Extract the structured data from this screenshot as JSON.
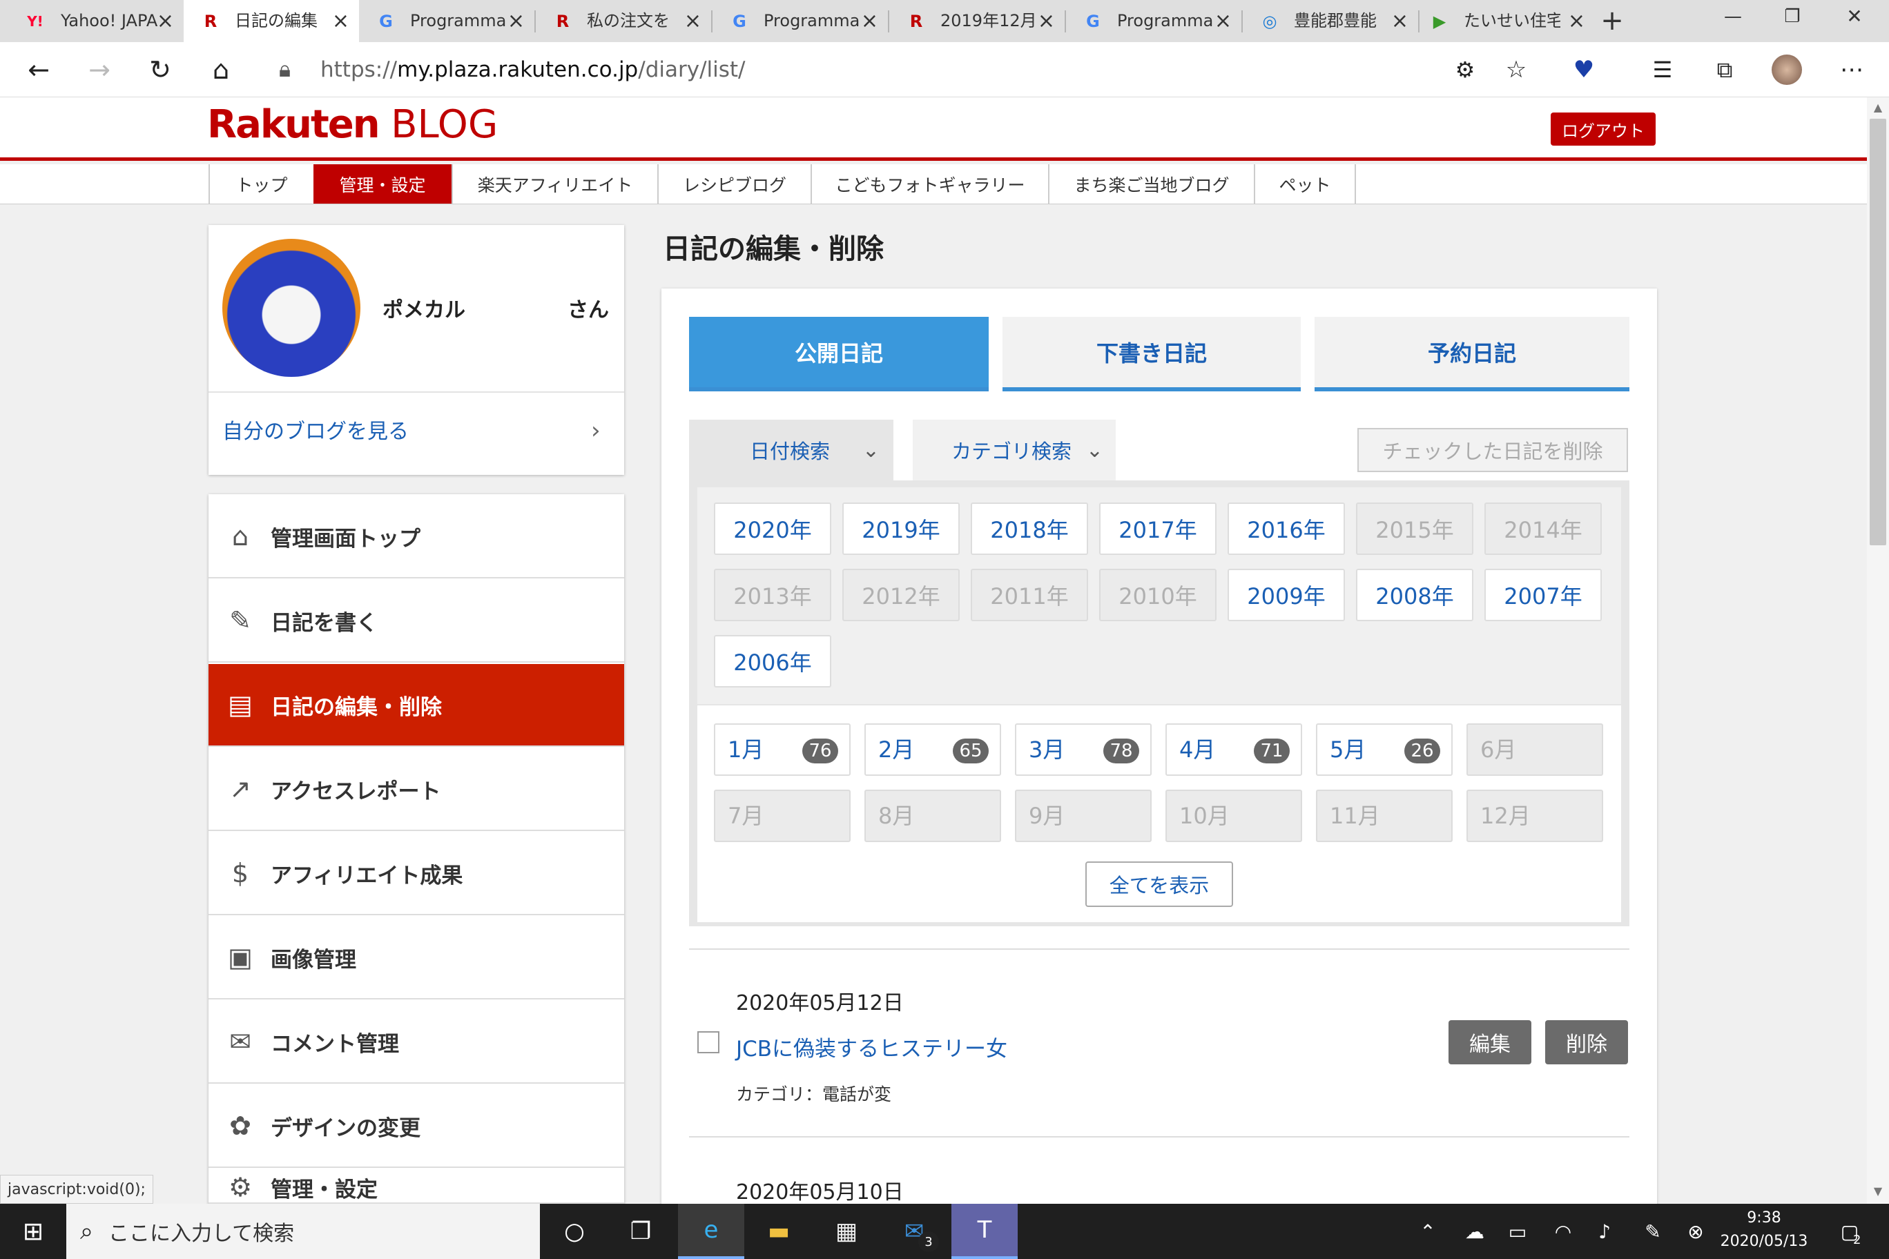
{
  "browser": {
    "tabs": [
      {
        "icon": "Y!",
        "title": "Yahoo! JAPA",
        "close": "×"
      },
      {
        "icon": "R",
        "title": "日記の編集",
        "close": "×"
      },
      {
        "icon": "G",
        "title": "Programma",
        "close": "×"
      },
      {
        "icon": "R",
        "title": "私の注文を",
        "close": "×"
      },
      {
        "icon": "G",
        "title": "Programma",
        "close": "×"
      },
      {
        "icon": "R",
        "title": "2019年12月",
        "close": "×"
      },
      {
        "icon": "G",
        "title": "Programma",
        "close": "×"
      },
      {
        "icon": "◎",
        "title": "豊能郡豊能",
        "close": "×"
      },
      {
        "icon": "▶",
        "title": "たいせい住宅",
        "close": "×"
      }
    ],
    "new_tab": "+",
    "url_prefix": "https://",
    "url_domain": "my.plaza.rakuten.co.jp",
    "url_path": "/diary/list/",
    "window_controls": [
      "—",
      "❐",
      "✕"
    ]
  },
  "site": {
    "logo_main": "Rakuten",
    "logo_sub": "BLOG",
    "logout": "ログアウト",
    "nav": [
      "トップ",
      "管理・設定",
      "楽天アフィリエイト",
      "レシピブログ",
      "こどもフォトギャラリー",
      "まち楽ご当地ブログ",
      "ペット"
    ]
  },
  "profile": {
    "name": "ポメカル",
    "honorific": "さん",
    "view_blog": "自分のブログを見る"
  },
  "sidebar": {
    "items": [
      {
        "label": "管理画面トップ",
        "icon": "⌂"
      },
      {
        "label": "日記を書く",
        "icon": "✎"
      },
      {
        "label": "日記の編集・削除",
        "icon": "▤"
      },
      {
        "label": "アクセスレポート",
        "icon": "↗"
      },
      {
        "label": "アフィリエイト成果",
        "icon": "$"
      },
      {
        "label": "画像管理",
        "icon": "▣"
      },
      {
        "label": "コメント管理",
        "icon": "✉"
      },
      {
        "label": "デザインの変更",
        "icon": "✿"
      },
      {
        "label": "管理・設定",
        "icon": "⚙"
      }
    ]
  },
  "main": {
    "title": "日記の編集・削除",
    "tabs": [
      "公開日記",
      "下書き日記",
      "予約日記"
    ],
    "search_tabs": [
      "日付検索",
      "カテゴリ検索"
    ],
    "delete_checked": "チェックした日記を削除",
    "years": [
      "2020年",
      "2019年",
      "2018年",
      "2017年",
      "2016年",
      "2015年",
      "2014年",
      "2013年",
      "2012年",
      "2011年",
      "2010年",
      "2009年",
      "2008年",
      "2007年",
      "2006年"
    ],
    "months": [
      {
        "label": "1月",
        "count": "76"
      },
      {
        "label": "2月",
        "count": "65"
      },
      {
        "label": "3月",
        "count": "78"
      },
      {
        "label": "4月",
        "count": "71"
      },
      {
        "label": "5月",
        "count": "26"
      },
      {
        "label": "6月",
        "count": ""
      },
      {
        "label": "7月",
        "count": ""
      },
      {
        "label": "8月",
        "count": ""
      },
      {
        "label": "9月",
        "count": ""
      },
      {
        "label": "10月",
        "count": ""
      },
      {
        "label": "11月",
        "count": ""
      },
      {
        "label": "12月",
        "count": ""
      }
    ],
    "show_all": "全てを表示",
    "entries": [
      {
        "date": "2020年05月12日",
        "title": "JCBに偽装するヒステリー女",
        "category": "カテゴリ：電話が変",
        "edit": "編集",
        "delete": "削除"
      },
      {
        "date": "2020年05月10日"
      }
    ]
  },
  "status_bar": "javascript:void(0);",
  "taskbar": {
    "search_placeholder": "ここに入力して検索",
    "mail_badge": "3",
    "time": "9:38",
    "date": "2020/05/13",
    "notif_badge": "2"
  },
  "colors": {
    "brand": "#bf0000",
    "link": "#1a5fb4",
    "tab_active": "#3a98dc"
  }
}
